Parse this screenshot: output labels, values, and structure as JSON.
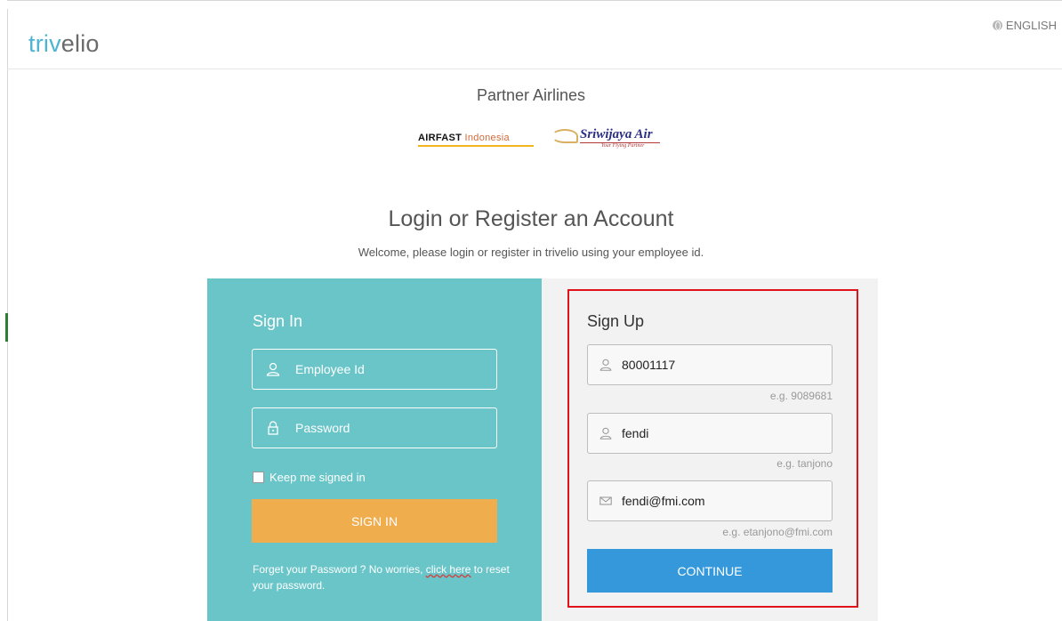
{
  "header": {
    "logo_part1": "triv",
    "logo_part2": "elio",
    "language": "ENGLISH"
  },
  "partners": {
    "title": "Partner Airlines",
    "airfast_bold": "AIRFAST",
    "airfast_sub": " Indonesia",
    "sriwijaya_name": "Sriwijaya Air",
    "sriwijaya_tagline": "Your Flying Partner"
  },
  "main": {
    "title": "Login or Register an Account",
    "welcome": "Welcome, please login or register in trivelio using your employee id."
  },
  "signin": {
    "title": "Sign In",
    "employee_placeholder": "Employee Id",
    "password_placeholder": "Password",
    "keep_signed": "Keep me signed in",
    "button": "SIGN IN",
    "forgot_prefix": "Forget your Password ? No worries, ",
    "forgot_link": "click here",
    "forgot_suffix": " to reset your password."
  },
  "signup": {
    "title": "Sign Up",
    "employee_value": "80001117",
    "employee_hint": "e.g. 9089681",
    "name_value": "fendi",
    "name_hint": "e.g. tanjono",
    "email_value": "fendi@fmi.com",
    "email_hint": "e.g. etanjono@fmi.com",
    "button": "CONTINUE"
  },
  "colors": {
    "signin_panel": "#69c5c8",
    "signup_panel": "#f2f2f2",
    "signin_button": "#f0ad4e",
    "continue_button": "#3498db",
    "highlight": "#e0121c",
    "logo_accent": "#4fb3d3"
  }
}
